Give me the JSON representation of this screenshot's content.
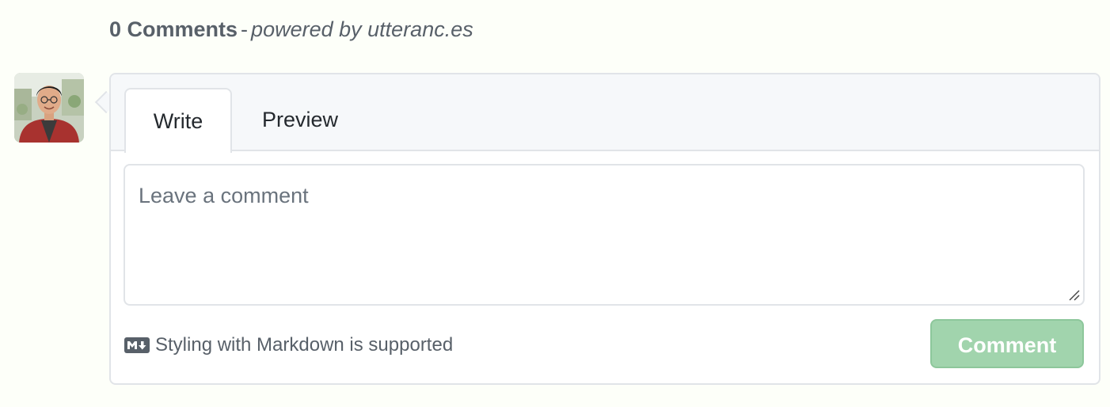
{
  "header": {
    "count_label": "0 Comments",
    "separator": "-",
    "powered_label": "powered by",
    "powered_link": "utteranc.es"
  },
  "avatar": {
    "icon": "user-avatar-photo"
  },
  "editor": {
    "tabs": [
      {
        "label": "Write",
        "active": true
      },
      {
        "label": "Preview",
        "active": false
      }
    ],
    "placeholder": "Leave a comment",
    "value": "",
    "markdown_icon": "markdown-icon",
    "markdown_hint": "Styling with Markdown is supported",
    "submit_label": "Comment",
    "submit_disabled": true
  },
  "colors": {
    "background": "#fdfff9",
    "tabbar": "#f6f8fa",
    "border": "#e1e4e8",
    "button_bg": "#a1d4ad",
    "button_border": "#8dc79b",
    "muted_text": "#586069"
  }
}
